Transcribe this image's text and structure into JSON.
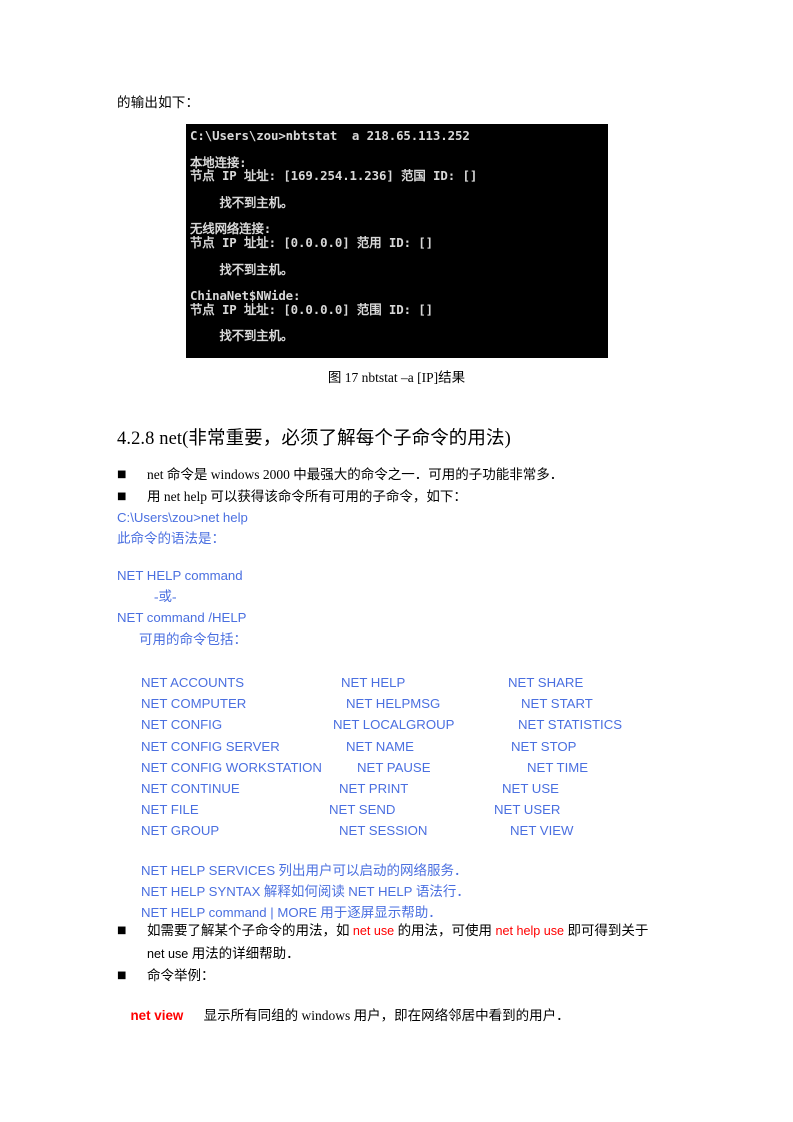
{
  "document": {
    "intro_line": "的输出如下：",
    "figure_caption": "图 17 nbtstat –a [IP]结果",
    "section_heading": "4.2.8 net(非常重要，必须了解每个子命令的用法)"
  },
  "terminal": {
    "bullet_glyph": "■",
    "lines": [
      "C:\\Users\\zou>nbtstat  a 218.65.113.252",
      "",
      "本地连接:",
      "节点 IP 址址: [169.254.1.236] 范国 ID: []",
      "",
      "    找不到主机。",
      "",
      "无线网络连接:",
      "节点 IP 址址: [0.0.0.0] 范用 ID: []",
      "",
      "    找不到主机。",
      "",
      "ChinaNet$NWide:",
      "节点 IP 址址: [0.0.0.0] 范围 ID: []",
      "",
      "    找不到主机。"
    ]
  },
  "bullets": {
    "glyph": "■",
    "items": [
      "net 命令是 windows 2000 中最强大的命令之一．可用的子功能非常多．",
      "用 net help 可以获得该命令所有可用的子命令，如下："
    ]
  },
  "console": {
    "prompt_line": "C:\\Users\\zou>net help",
    "syntax_intro": "此命令的语法是："
  },
  "syntax": {
    "line1": "NET HELP command",
    "line2": "-或-",
    "line3": "NET command /HELP",
    "line4": "可用的命令包括："
  },
  "commands": {
    "rows": [
      {
        "c1": "NET ACCOUNTS",
        "c2": "NET HELP",
        "c2x": 200,
        "c3": "NET SHARE",
        "c3x": 367
      },
      {
        "c1": "NET COMPUTER",
        "c2": "NET HELPMSG",
        "c2x": 205,
        "c3": "NET START",
        "c3x": 380
      },
      {
        "c1": "NET CONFIG",
        "c2": "NET LOCALGROUP",
        "c2x": 192,
        "c3": "NET STATISTICS",
        "c3x": 377
      },
      {
        "c1": "NET CONFIG SERVER",
        "c2": "NET NAME",
        "c2x": 205,
        "c3": "NET STOP",
        "c3x": 370
      },
      {
        "c1": "NET CONFIG WORKSTATION",
        "c2": "NET PAUSE",
        "c2x": 216,
        "c3": "NET TIME",
        "c3x": 386
      },
      {
        "c1": "NET CONTINUE",
        "c2": "NET PRINT",
        "c2x": 198,
        "c3": "NET USE",
        "c3x": 361
      },
      {
        "c1": "NET FILE",
        "c2": "NET SEND",
        "c2x": 188,
        "c3": "NET USER",
        "c3x": 353
      },
      {
        "c1": "NET GROUP",
        "c2": "NET SESSION",
        "c2x": 198,
        "c3": "NET VIEW",
        "c3x": 369
      }
    ]
  },
  "help_lines": [
    {
      "cmd": "NET HELP SERVICES",
      "desc": " 列出用户可以启动的网络服务．"
    },
    {
      "cmd": "NET HELP SYNTAX",
      "desc": " 解释如何阅读 ",
      "cmd2": "NET HELP",
      "desc2": " 语法行．"
    },
    {
      "cmd": "NET HELP command | MORE",
      "desc": " 用于逐屏显示帮助．"
    }
  ],
  "tail": {
    "glyph": "■",
    "item1_pre": "如需要了解某个子命令的用法，如 ",
    "item1_red1": "net use",
    "item1_mid": " 的用法，可使用 ",
    "item1_red2": "net help use",
    "item1_post": " 即可得到关于",
    "item1_line2_cmd": "net use",
    "item1_line2_rest": " 用法的详细帮助．",
    "item2": "命令举例："
  },
  "example": {
    "command": "net view",
    "spacer": "      ",
    "description": "显示所有同组的 windows 用户，即在网络邻居中看到的用户．"
  },
  "colors": {
    "blue": "#4a6fe0",
    "red": "#ff0000",
    "terminal_bg": "#000000",
    "terminal_fg": "#d8d8d8"
  }
}
